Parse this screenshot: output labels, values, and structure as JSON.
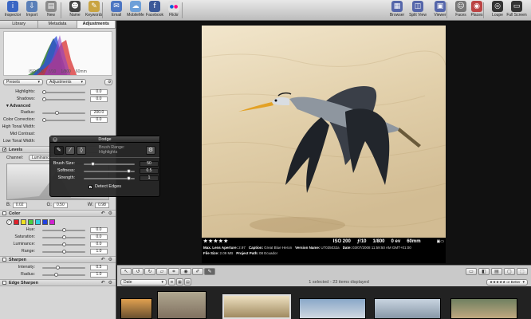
{
  "toolbar": {
    "left": [
      {
        "label": "Inspector",
        "icon": "info-icon",
        "glyph": "i",
        "color": "#3a66c4"
      },
      {
        "label": "Import",
        "icon": "import-icon",
        "glyph": "⇩",
        "color": "#5a7fb8"
      },
      {
        "label": "New",
        "icon": "new-icon",
        "glyph": "▤",
        "color": "#8a8a8a"
      },
      {
        "label": "Name",
        "icon": "name-icon",
        "glyph": "☻",
        "color": "#444"
      },
      {
        "label": "Keywords",
        "icon": "keywords-icon",
        "glyph": "✎",
        "color": "#c9a441"
      },
      {
        "label": "Email",
        "icon": "email-icon",
        "glyph": "✉",
        "color": "#4c75c2"
      },
      {
        "label": "MobileMe",
        "icon": "mobileme-icon",
        "glyph": "☁",
        "color": "#6ea0d8"
      },
      {
        "label": "Facebook",
        "icon": "facebook-icon",
        "glyph": "f",
        "color": "#3b5998"
      },
      {
        "label": "Flickr",
        "icon": "flickr-icon",
        "glyph": "●●",
        "color": "#e0e0e0"
      }
    ],
    "right": [
      {
        "label": "Browser",
        "icon": "browser-icon",
        "glyph": "▦",
        "color": "#5566aa"
      },
      {
        "label": "Split View",
        "icon": "split-view-icon",
        "glyph": "◫",
        "color": "#5566aa"
      },
      {
        "label": "Viewer",
        "icon": "viewer-icon",
        "glyph": "▣",
        "color": "#5566aa"
      },
      {
        "label": "Faces",
        "icon": "faces-icon",
        "glyph": "☺",
        "color": "#777"
      },
      {
        "label": "Places",
        "icon": "places-icon",
        "glyph": "◉",
        "color": "#b44"
      },
      {
        "label": "Loupe",
        "icon": "loupe-icon",
        "glyph": "◎",
        "color": "#333"
      },
      {
        "label": "Full Screen",
        "icon": "full-screen-icon",
        "glyph": "▭",
        "color": "#333"
      }
    ]
  },
  "left_panel": {
    "tabs": [
      {
        "label": "Library",
        "active": false
      },
      {
        "label": "Metadata",
        "active": false
      },
      {
        "label": "Adjustments",
        "active": true
      }
    ],
    "histogram_meta": [
      "ISO 200",
      "ƒ/10",
      "1/800",
      "60mm"
    ],
    "presets_label": "Presets",
    "adjustments_label": "Adjustments",
    "rows1": [
      {
        "label": "Highlights:",
        "value": "0.0",
        "pos": 0
      },
      {
        "label": "Shadows:",
        "value": "0.0",
        "pos": 0
      }
    ],
    "advanced_label": "Advanced",
    "rows2": [
      {
        "label": "Radius:",
        "value": "200.0",
        "pos": 0.33
      },
      {
        "label": "Color Correction:",
        "value": "0.0",
        "pos": 0
      },
      {
        "label": "High Tonal Width:",
        "value": "",
        "pos": 0
      },
      {
        "label": "Mid Contrast:",
        "value": "",
        "pos": 0
      },
      {
        "label": "Low Tonal Width:",
        "value": "",
        "pos": 0
      }
    ],
    "levels_label": "Levels",
    "channel_label": "Channel:",
    "channel_value": "Luminance",
    "levels_values": [
      {
        "letter": "B:",
        "value": "0.02"
      },
      {
        "letter": "G:",
        "value": "0.50"
      },
      {
        "letter": "W:",
        "value": "0.98"
      }
    ],
    "color_label": "Color",
    "color_swatches": [
      "#e0202a",
      "#f0e020",
      "#4bd040",
      "#30d0e0",
      "#2040e0",
      "#d020d0"
    ],
    "color_rows": [
      {
        "label": "Hue:",
        "value": "0.0",
        "pos": 0.5
      },
      {
        "label": "Saturation:",
        "value": "0.0",
        "pos": 0.5
      },
      {
        "label": "Luminance:",
        "value": "0.0",
        "pos": 0.5
      },
      {
        "label": "Range:",
        "value": "1.0",
        "pos": 0.5
      }
    ],
    "sharpen_label": "Sharpen",
    "sharpen_rows": [
      {
        "label": "Intensity:",
        "value": "0.5",
        "pos": 0.35
      },
      {
        "label": "Radius:",
        "value": "1.0",
        "pos": 0.3
      }
    ],
    "edge_sharpen_label": "Edge Sharpen"
  },
  "hud": {
    "title": "Dodge",
    "brush_range": "Brush Range: Highlights",
    "rows": [
      {
        "label": "Brush Size:",
        "value": "50",
        "pos": 0.15
      },
      {
        "label": "Softness:",
        "value": "0.5",
        "pos": 0.92
      },
      {
        "label": "Strength:",
        "value": "1",
        "pos": 0.92
      }
    ],
    "detect_edges": "Detect Edges"
  },
  "info": {
    "stars": "★★★★★",
    "iso": "ISO 200",
    "aperture": "ƒ/10",
    "shutter": "1/800",
    "ev": "0 ev",
    "focal": "60mm",
    "line1": [
      {
        "k": "Max. Lens Aperture:",
        "v": "2.97"
      },
      {
        "k": "Caption:",
        "v": "Great Blue Heron"
      },
      {
        "k": "Version Name:",
        "v": "U7035032a"
      },
      {
        "k": "Date:",
        "v": "03/07/2008 11:59:50 AM GMT+01:00"
      }
    ],
    "line2": [
      {
        "k": "File Size:",
        "v": "2.09 MB"
      },
      {
        "k": "Project Path:",
        "v": "08 Ecuador"
      }
    ]
  },
  "strip": {
    "sort_label": "Date",
    "status": "1 selected - 23 items displayed",
    "rating_filter": "★★★★★ or Better"
  }
}
